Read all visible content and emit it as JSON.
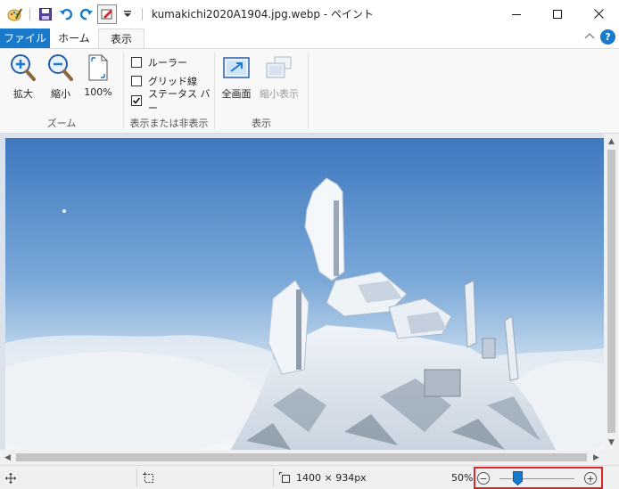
{
  "window": {
    "title": "kumakichi2020A1904.jpg.webp - ペイント"
  },
  "quick_access": {
    "icons": [
      "paint-app-icon",
      "save-icon",
      "undo-icon",
      "redo-icon",
      "customize-icon",
      "dropdown-arrow-icon"
    ]
  },
  "tabs": {
    "file": "ファイル",
    "home": "ホーム",
    "view": "表示"
  },
  "ribbon": {
    "zoom_group": {
      "label": "ズーム",
      "zoom_in": "拡大",
      "zoom_out": "縮小",
      "actual_size": "100%"
    },
    "show_hide_group": {
      "label": "表示または非表示",
      "ruler": "ルーラー",
      "gridlines": "グリッド線",
      "status_bar": "ステータス バー",
      "ruler_checked": false,
      "gridlines_checked": false,
      "status_bar_checked": true
    },
    "display_group": {
      "label": "表示",
      "fullscreen": "全画面",
      "thumbnail": "縮小表示"
    }
  },
  "status": {
    "image_size": "1400 × 934px",
    "zoom_percent": "50%",
    "zoom_level_fraction": 0.5
  },
  "colors": {
    "accent": "#1979ca",
    "highlight_box": "#d9272c",
    "ribbon_bg": "#f8f8f8",
    "workspace_bg": "#dbe2ec"
  }
}
